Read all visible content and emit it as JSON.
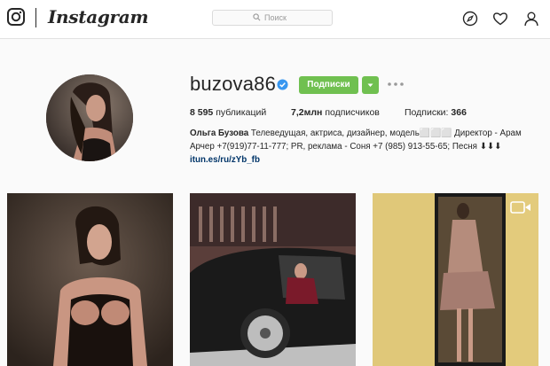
{
  "nav": {
    "wordmark": "Instagram",
    "search_placeholder": "Поиск",
    "icons": [
      "instagram-camera-icon",
      "explore-compass-icon",
      "activity-heart-icon",
      "profile-person-icon"
    ]
  },
  "profile": {
    "username": "buzova86",
    "verified": true,
    "follow_label": "Подписки",
    "posts_count": "8 595",
    "posts_label": "публикаций",
    "followers_count": "7,2млн",
    "followers_label": "подписчиков",
    "following_label": "Подписки:",
    "following_count": "366",
    "bio_name": "Ольга Бузова",
    "bio_line1_rest": " Телеведущая, актриса, дизайнер, модель⬜⬜⬜ Директор - Арам",
    "bio_line2": "Арчер +7(919)77-11-777; PR, реклама - Соня +7 (985) 913-55-65; Песня ⬇⬇⬇",
    "bio_link": "itun.es/ru/zYb_fb"
  },
  "colors": {
    "accent_green": "#70c050",
    "verified_blue": "#3897f0",
    "link_blue": "#003569"
  },
  "posts": [
    {
      "type": "photo"
    },
    {
      "type": "photo"
    },
    {
      "type": "video"
    }
  ]
}
